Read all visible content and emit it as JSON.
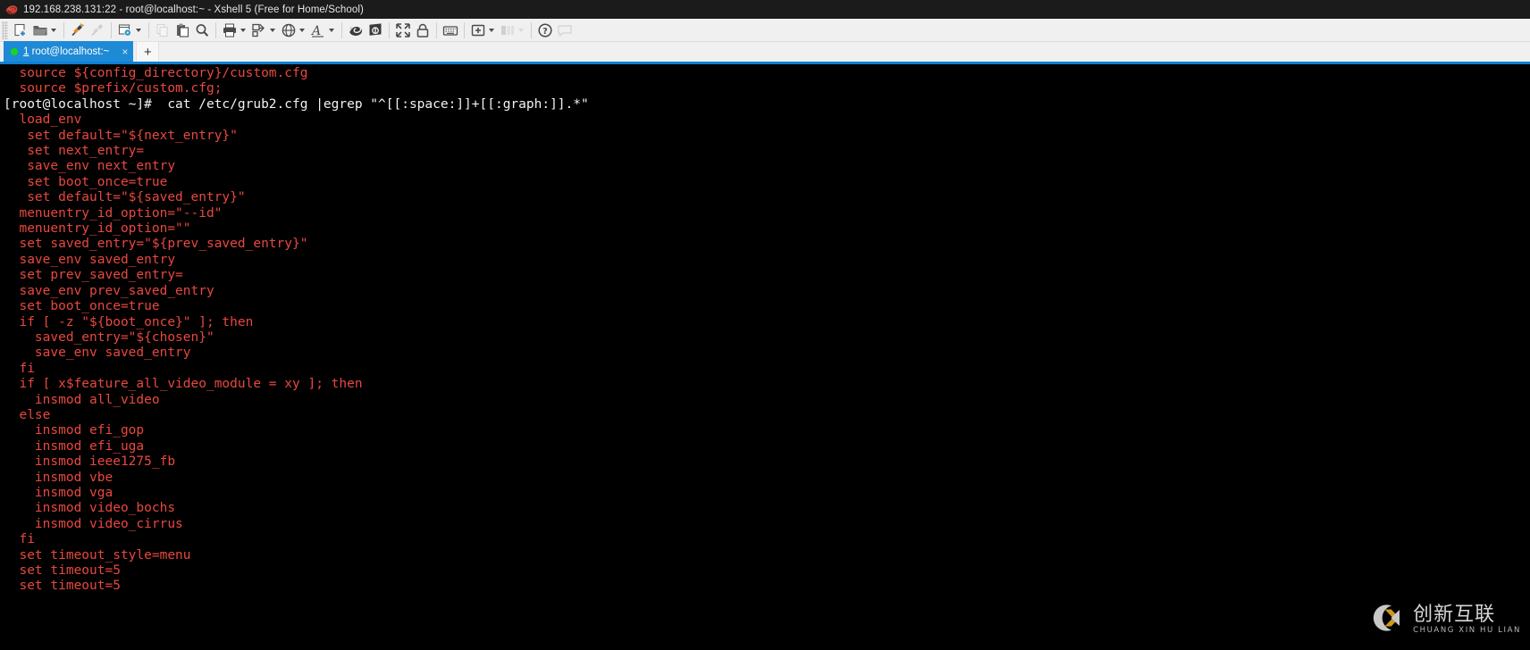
{
  "window": {
    "title": "192.168.238.131:22 - root@localhost:~ - Xshell 5 (Free for Home/School)",
    "app_icon": "xshell-icon"
  },
  "toolbar": {
    "groups": [
      {
        "buttons": [
          {
            "name": "new-session-button",
            "icon": "new-file-icon",
            "caret": false,
            "disabled": false
          },
          {
            "name": "open-session-button",
            "icon": "open-folder-icon",
            "caret": true,
            "disabled": false
          }
        ]
      },
      {
        "buttons": [
          {
            "name": "connect-button",
            "icon": "connect-plug-icon",
            "caret": false,
            "disabled": false
          },
          {
            "name": "disconnect-button",
            "icon": "disconnect-plug-icon",
            "caret": false,
            "disabled": true
          }
        ]
      },
      {
        "buttons": [
          {
            "name": "session-properties-button",
            "icon": "properties-gear-icon",
            "caret": true,
            "disabled": false
          }
        ]
      },
      {
        "buttons": [
          {
            "name": "copy-button",
            "icon": "copy-icon",
            "caret": false,
            "disabled": true
          },
          {
            "name": "paste-button",
            "icon": "paste-icon",
            "caret": false,
            "disabled": false
          },
          {
            "name": "find-button",
            "icon": "search-icon",
            "caret": false,
            "disabled": false
          }
        ]
      },
      {
        "buttons": [
          {
            "name": "print-button",
            "icon": "printer-icon",
            "caret": true,
            "disabled": false
          },
          {
            "name": "file-transfer-button",
            "icon": "file-transfer-icon",
            "caret": true,
            "disabled": false
          }
        ]
      },
      {
        "buttons": [
          {
            "name": "browser-button",
            "icon": "globe-icon",
            "caret": true,
            "disabled": false
          },
          {
            "name": "font-button",
            "icon": "font-a-icon",
            "caret": true,
            "disabled": false
          }
        ]
      },
      {
        "buttons": [
          {
            "name": "xshell-button",
            "icon": "shell-spiral-icon",
            "caret": false,
            "disabled": false
          },
          {
            "name": "xftp-button",
            "icon": "xftp-icon",
            "caret": false,
            "disabled": false
          }
        ]
      },
      {
        "buttons": [
          {
            "name": "fullscreen-button",
            "icon": "fullscreen-arrows-icon",
            "caret": false,
            "disabled": false
          },
          {
            "name": "lock-button",
            "icon": "lock-icon",
            "caret": false,
            "disabled": false
          }
        ]
      },
      {
        "buttons": [
          {
            "name": "keyboard-button",
            "icon": "keyboard-icon",
            "caret": false,
            "disabled": false
          }
        ]
      },
      {
        "buttons": [
          {
            "name": "add-panel-button",
            "icon": "add-panel-icon",
            "caret": true,
            "disabled": false
          },
          {
            "name": "arrange-layout-button",
            "icon": "layout-icon",
            "caret": true,
            "disabled": true
          }
        ]
      },
      {
        "buttons": [
          {
            "name": "help-button",
            "icon": "help-question-icon",
            "caret": false,
            "disabled": false
          },
          {
            "name": "chat-button",
            "icon": "chat-bubble-icon",
            "caret": false,
            "disabled": true
          }
        ]
      }
    ]
  },
  "tabs": {
    "active_index": 0,
    "items": [
      {
        "number": "1",
        "label": " root@localhost:~",
        "status": "connected",
        "close_glyph": "×"
      }
    ],
    "new_tab_glyph": "+"
  },
  "terminal": {
    "lines": [
      {
        "text": "  source ${config_directory}/custom.cfg",
        "color": "red"
      },
      {
        "text": "  source $prefix/custom.cfg;",
        "color": "red"
      },
      {
        "text": "[root@localhost ~]#  cat /etc/grub2.cfg |egrep \"^[[:space:]]+[[:graph:]].*\"",
        "color": "white"
      },
      {
        "text": "  load_env",
        "color": "red"
      },
      {
        "text": "   set default=\"${next_entry}\"",
        "color": "red"
      },
      {
        "text": "   set next_entry=",
        "color": "red"
      },
      {
        "text": "   save_env next_entry",
        "color": "red"
      },
      {
        "text": "   set boot_once=true",
        "color": "red"
      },
      {
        "text": "   set default=\"${saved_entry}\"",
        "color": "red"
      },
      {
        "text": "  menuentry_id_option=\"--id\"",
        "color": "red"
      },
      {
        "text": "  menuentry_id_option=\"\"",
        "color": "red"
      },
      {
        "text": "  set saved_entry=\"${prev_saved_entry}\"",
        "color": "red"
      },
      {
        "text": "  save_env saved_entry",
        "color": "red"
      },
      {
        "text": "  set prev_saved_entry=",
        "color": "red"
      },
      {
        "text": "  save_env prev_saved_entry",
        "color": "red"
      },
      {
        "text": "  set boot_once=true",
        "color": "red"
      },
      {
        "text": "  if [ -z \"${boot_once}\" ]; then",
        "color": "red"
      },
      {
        "text": "    saved_entry=\"${chosen}\"",
        "color": "red"
      },
      {
        "text": "    save_env saved_entry",
        "color": "red"
      },
      {
        "text": "  fi",
        "color": "red"
      },
      {
        "text": "  if [ x$feature_all_video_module = xy ]; then",
        "color": "red"
      },
      {
        "text": "    insmod all_video",
        "color": "red"
      },
      {
        "text": "  else",
        "color": "red"
      },
      {
        "text": "    insmod efi_gop",
        "color": "red"
      },
      {
        "text": "    insmod efi_uga",
        "color": "red"
      },
      {
        "text": "    insmod ieee1275_fb",
        "color": "red"
      },
      {
        "text": "    insmod vbe",
        "color": "red"
      },
      {
        "text": "    insmod vga",
        "color": "red"
      },
      {
        "text": "    insmod video_bochs",
        "color": "red"
      },
      {
        "text": "    insmod video_cirrus",
        "color": "red"
      },
      {
        "text": "  fi",
        "color": "red"
      },
      {
        "text": "  set timeout_style=menu",
        "color": "red"
      },
      {
        "text": "  set timeout=5",
        "color": "red"
      },
      {
        "text": "  set timeout=5",
        "color": "red"
      }
    ],
    "colors": {
      "background": "#000000",
      "text_red": "#e8483f",
      "text_white": "#f2f2f2"
    }
  },
  "watermark": {
    "chinese": "创新互联",
    "pinyin": "CHUANG XIN HU LIAN",
    "logo_ring_color": "#d9d9d9",
    "logo_x_color": "#e0a423"
  }
}
